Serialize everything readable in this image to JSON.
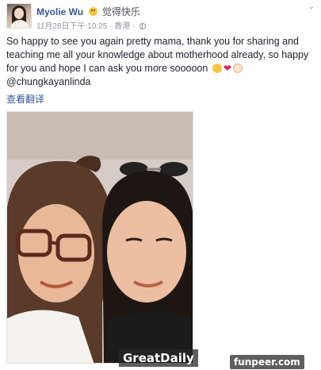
{
  "post": {
    "author": "Myolie Wu",
    "feeling": "觉得快乐",
    "timestamp": "11月28日下午 10:25",
    "separator": "·",
    "location": "香港",
    "text": "So happy to see you again pretty mama, thank you for sharing and teaching me all your knowledge about motherhood already, so happy for you and hope I can ask you more sooooon",
    "mention": "@chungkayanlinda",
    "see_translation": "查看翻译",
    "heart": "❤"
  },
  "icons": {
    "menu": "chevron-down-icon",
    "audience": "globe-icon",
    "feeling": "smile-icon"
  },
  "watermarks": {
    "left": "GreatDaily",
    "right": "funpeer.com"
  }
}
